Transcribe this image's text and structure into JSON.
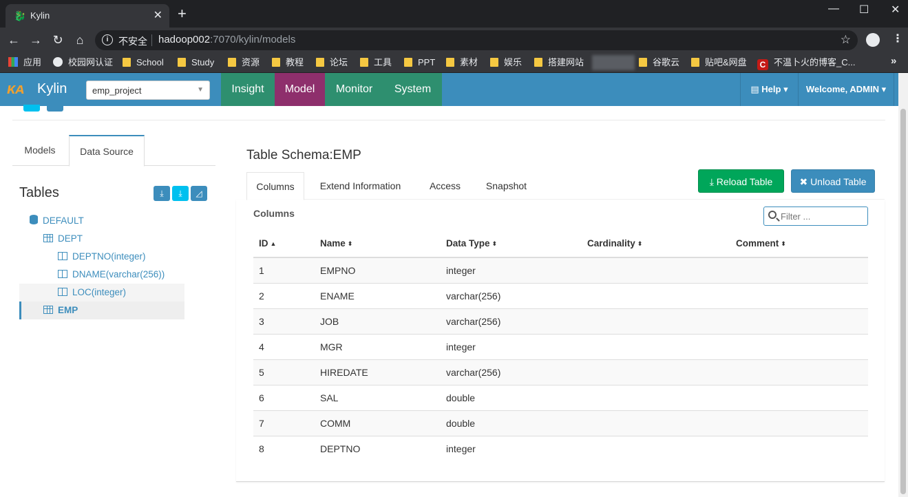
{
  "browser": {
    "tab_title": "Kylin",
    "tab_close": "✕",
    "new_tab": "+",
    "insecure_label": "不安全",
    "url_host": "hadoop002",
    "url_rest": ":7070/kylin/models",
    "bookmarks": [
      "应用",
      "校园网认证",
      "School",
      "Study",
      "资源",
      "教程",
      "论坛",
      "工具",
      "PPT",
      "素材",
      "娱乐",
      "搭建网站",
      "谷歌云",
      "贴吧&网盘",
      "不温卜火的博客_C..."
    ],
    "bookmarks_more": "»"
  },
  "app": {
    "brand": "Kylin",
    "logo_text": "ᴋᴀ",
    "project": "emp_project",
    "nav_tabs": [
      "Insight",
      "Model",
      "Monitor",
      "System"
    ],
    "help_label": "Help",
    "welcome_label": "Welcome, ADMIN",
    "colors": {
      "navbar": "#3c8dbc",
      "insight": "#2e8f6f",
      "model_active": "#8e2f6c",
      "monitor": "#2e8f6f",
      "system": "#2e8f6f",
      "success": "#00a65a"
    }
  },
  "left": {
    "tabs": [
      "Models",
      "Data Source"
    ],
    "active_tab": "Data Source",
    "tables_title": "Tables",
    "tree": [
      {
        "label": "DEFAULT",
        "icon": "database-icon"
      },
      {
        "label": "DEPT",
        "icon": "table-icon"
      },
      {
        "label": "DEPTNO(integer)",
        "icon": "column-icon"
      },
      {
        "label": "DNAME(varchar(256))",
        "icon": "column-icon"
      },
      {
        "label": "LOC(integer)",
        "icon": "column-icon"
      },
      {
        "label": "EMP",
        "icon": "table-icon"
      }
    ]
  },
  "schema": {
    "title": "Table Schema:EMP",
    "reload_label": "Reload Table",
    "unload_label": "Unload Table",
    "tabs": [
      "Columns",
      "Extend Information",
      "Access",
      "Snapshot"
    ],
    "active_tab": "Columns",
    "panel_title": "Columns",
    "filter_placeholder": "Filter ...",
    "headers": [
      "ID",
      "Name",
      "Data Type",
      "Cardinality",
      "Comment"
    ],
    "rows": [
      {
        "id": "1",
        "name": "EMPNO",
        "type": "integer"
      },
      {
        "id": "2",
        "name": "ENAME",
        "type": "varchar(256)"
      },
      {
        "id": "3",
        "name": "JOB",
        "type": "varchar(256)"
      },
      {
        "id": "4",
        "name": "MGR",
        "type": "integer"
      },
      {
        "id": "5",
        "name": "HIREDATE",
        "type": "varchar(256)"
      },
      {
        "id": "6",
        "name": "SAL",
        "type": "double"
      },
      {
        "id": "7",
        "name": "COMM",
        "type": "double"
      },
      {
        "id": "8",
        "name": "DEPTNO",
        "type": "integer"
      }
    ]
  }
}
